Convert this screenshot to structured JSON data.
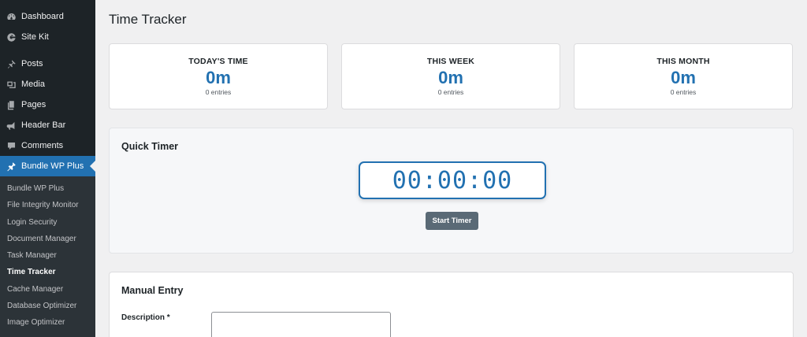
{
  "sidebar": {
    "menu": [
      {
        "label": "Dashboard",
        "icon": "dashboard-icon"
      },
      {
        "label": "Site Kit",
        "icon": "google-g-icon"
      },
      {
        "label": "Posts",
        "icon": "pin-icon"
      },
      {
        "label": "Media",
        "icon": "media-icon"
      },
      {
        "label": "Pages",
        "icon": "pages-icon"
      },
      {
        "label": "Header Bar",
        "icon": "megaphone-icon"
      },
      {
        "label": "Comments",
        "icon": "comment-icon"
      },
      {
        "label": "Bundle WP Plus",
        "icon": "plugin-icon",
        "active": true
      }
    ],
    "submenu": [
      {
        "label": "Bundle WP Plus"
      },
      {
        "label": "File Integrity Monitor"
      },
      {
        "label": "Login Security"
      },
      {
        "label": "Document Manager"
      },
      {
        "label": "Task Manager"
      },
      {
        "label": "Time Tracker",
        "current": true
      },
      {
        "label": "Cache Manager"
      },
      {
        "label": "Database Optimizer"
      },
      {
        "label": "Image Optimizer"
      }
    ]
  },
  "page": {
    "title": "Time Tracker"
  },
  "stats": [
    {
      "label": "TODAY'S TIME",
      "value": "0m",
      "entries": "0 entries"
    },
    {
      "label": "THIS WEEK",
      "value": "0m",
      "entries": "0 entries"
    },
    {
      "label": "THIS MONTH",
      "value": "0m",
      "entries": "0 entries"
    }
  ],
  "quick_timer": {
    "title": "Quick Timer",
    "display": "00:00:00",
    "start_label": "Start Timer"
  },
  "manual_entry": {
    "title": "Manual Entry",
    "description_label": "Description *",
    "description_value": ""
  },
  "colors": {
    "accent": "#2271b1",
    "sidebar_bg": "#1d2327",
    "submenu_bg": "#2c3338",
    "button_bg": "#5a6a76"
  }
}
